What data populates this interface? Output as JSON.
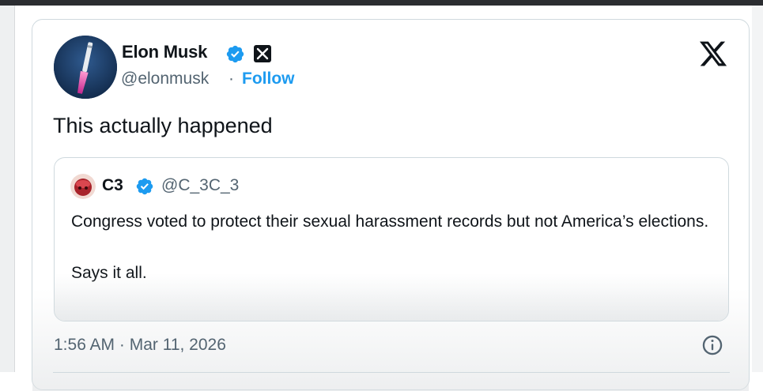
{
  "tweet": {
    "author": {
      "name": "Elon Musk",
      "handle": "@elonmusk",
      "separator": "·",
      "follow_label": "Follow",
      "avatar_icon": "rocket-launch-avatar",
      "verified_icon": "verified-badge-icon",
      "affiliate_icon": "x-affiliate-badge-icon"
    },
    "platform_icon": "x-logo-icon",
    "text": "This actually happened",
    "quoted": {
      "name": "C3",
      "handle": "@C_3C_3",
      "avatar_icon": "c3-avatar",
      "verified_icon": "verified-badge-icon",
      "text_lines": [
        "Congress voted to protect their sexual harassment records but not America’s elections.",
        "Says it all."
      ]
    },
    "timestamp": "1:56 AM · Mar 11, 2026",
    "info_icon": "info-icon"
  },
  "colors": {
    "text_primary": "#0f1419",
    "text_secondary": "#536471",
    "accent": "#1d9bf0",
    "border": "#cfd9de",
    "top_bar": "#2b2d31"
  }
}
